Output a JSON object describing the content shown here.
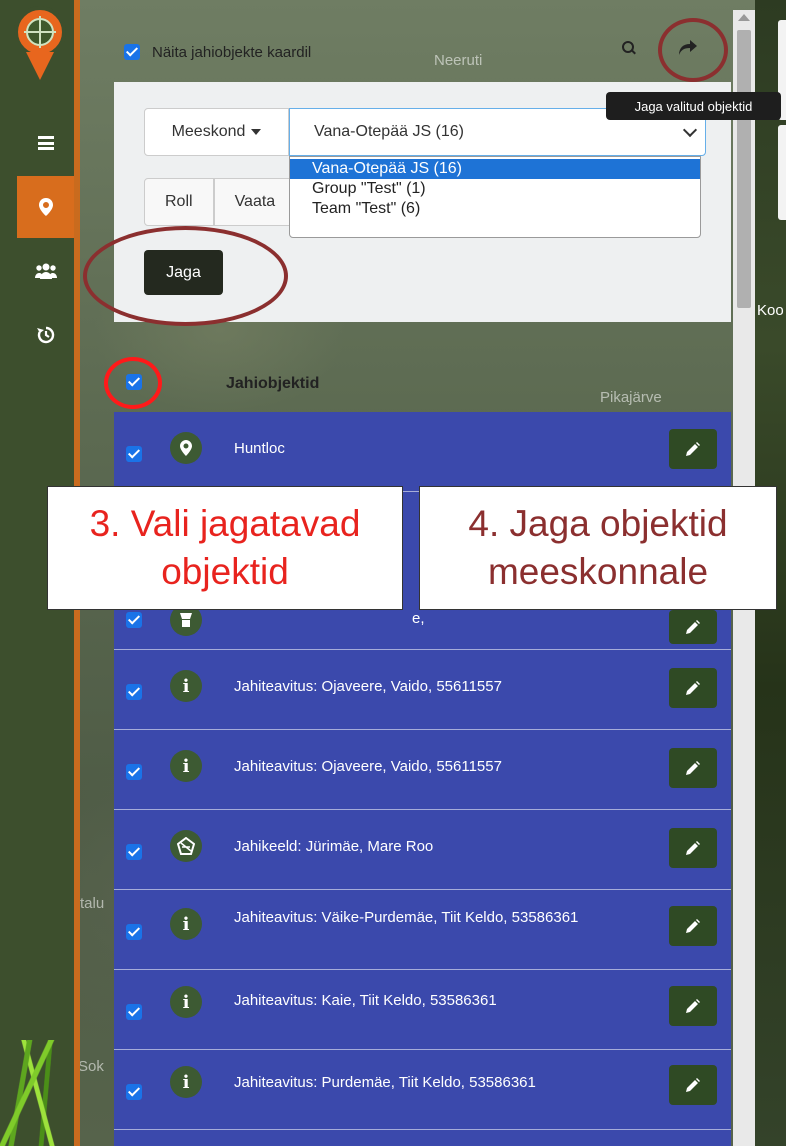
{
  "map": {
    "labels": [
      "Neeruti",
      "Pikajärve",
      "Koo",
      "talu",
      "Sok"
    ]
  },
  "sidebar": {
    "items": [
      {
        "icon": "menu-icon"
      },
      {
        "icon": "map-pin-icon",
        "active": true
      },
      {
        "icon": "users-icon"
      },
      {
        "icon": "history-icon"
      }
    ]
  },
  "toolbar": {
    "show_on_map_label": "Näita jahiobjekte kaardil",
    "share_tooltip": "Jaga valitud objektid"
  },
  "filter": {
    "team_label": "Meeskond",
    "team_selected": "Vana-Otepää JS (16)",
    "team_options": [
      "Vana-Otepää JS (16)",
      "Group \"Test\" (1)",
      "Team \"Test\" (6)"
    ],
    "tabs": [
      "Roll",
      "Vaata"
    ],
    "share_button": "Jaga"
  },
  "list": {
    "title": "Jahiobjektid",
    "items": [
      {
        "icon": "location-icon",
        "text": "Huntloc"
      },
      {
        "icon": "tower-icon",
        "text": "e,"
      },
      {
        "icon": "info-icon",
        "text": "Jahiteavitus: Ojaveere, Vaido, 55611557"
      },
      {
        "icon": "info-icon",
        "text": "Jahiteavitus: Ojaveere, Vaido, 55611557"
      },
      {
        "icon": "no-hunting-icon",
        "text": "Jahikeeld: Jürimäe, Mare Roo"
      },
      {
        "icon": "info-icon",
        "text": "Jahiteavitus: Väike-Purdemäe, Tiit Keldo, 53586361"
      },
      {
        "icon": "info-icon",
        "text": "Jahiteavitus: Kaie, Tiit Keldo, 53586361"
      },
      {
        "icon": "info-icon",
        "text": "Jahiteavitus: Purdemäe, Tiit Keldo, 53586361"
      }
    ]
  },
  "annotations": {
    "step3": "3. Vali jagatavad objektid",
    "step4": "4. Jaga objektid meeskonnale"
  },
  "colors": {
    "sidebar": "#3d4f2d",
    "accent_orange": "#d86d1d",
    "list_blue": "#3b49ac",
    "edit_green": "#2f4a24",
    "annotation_red": "#ff1a1a",
    "annotation_dark_red": "#8b2f2f"
  }
}
